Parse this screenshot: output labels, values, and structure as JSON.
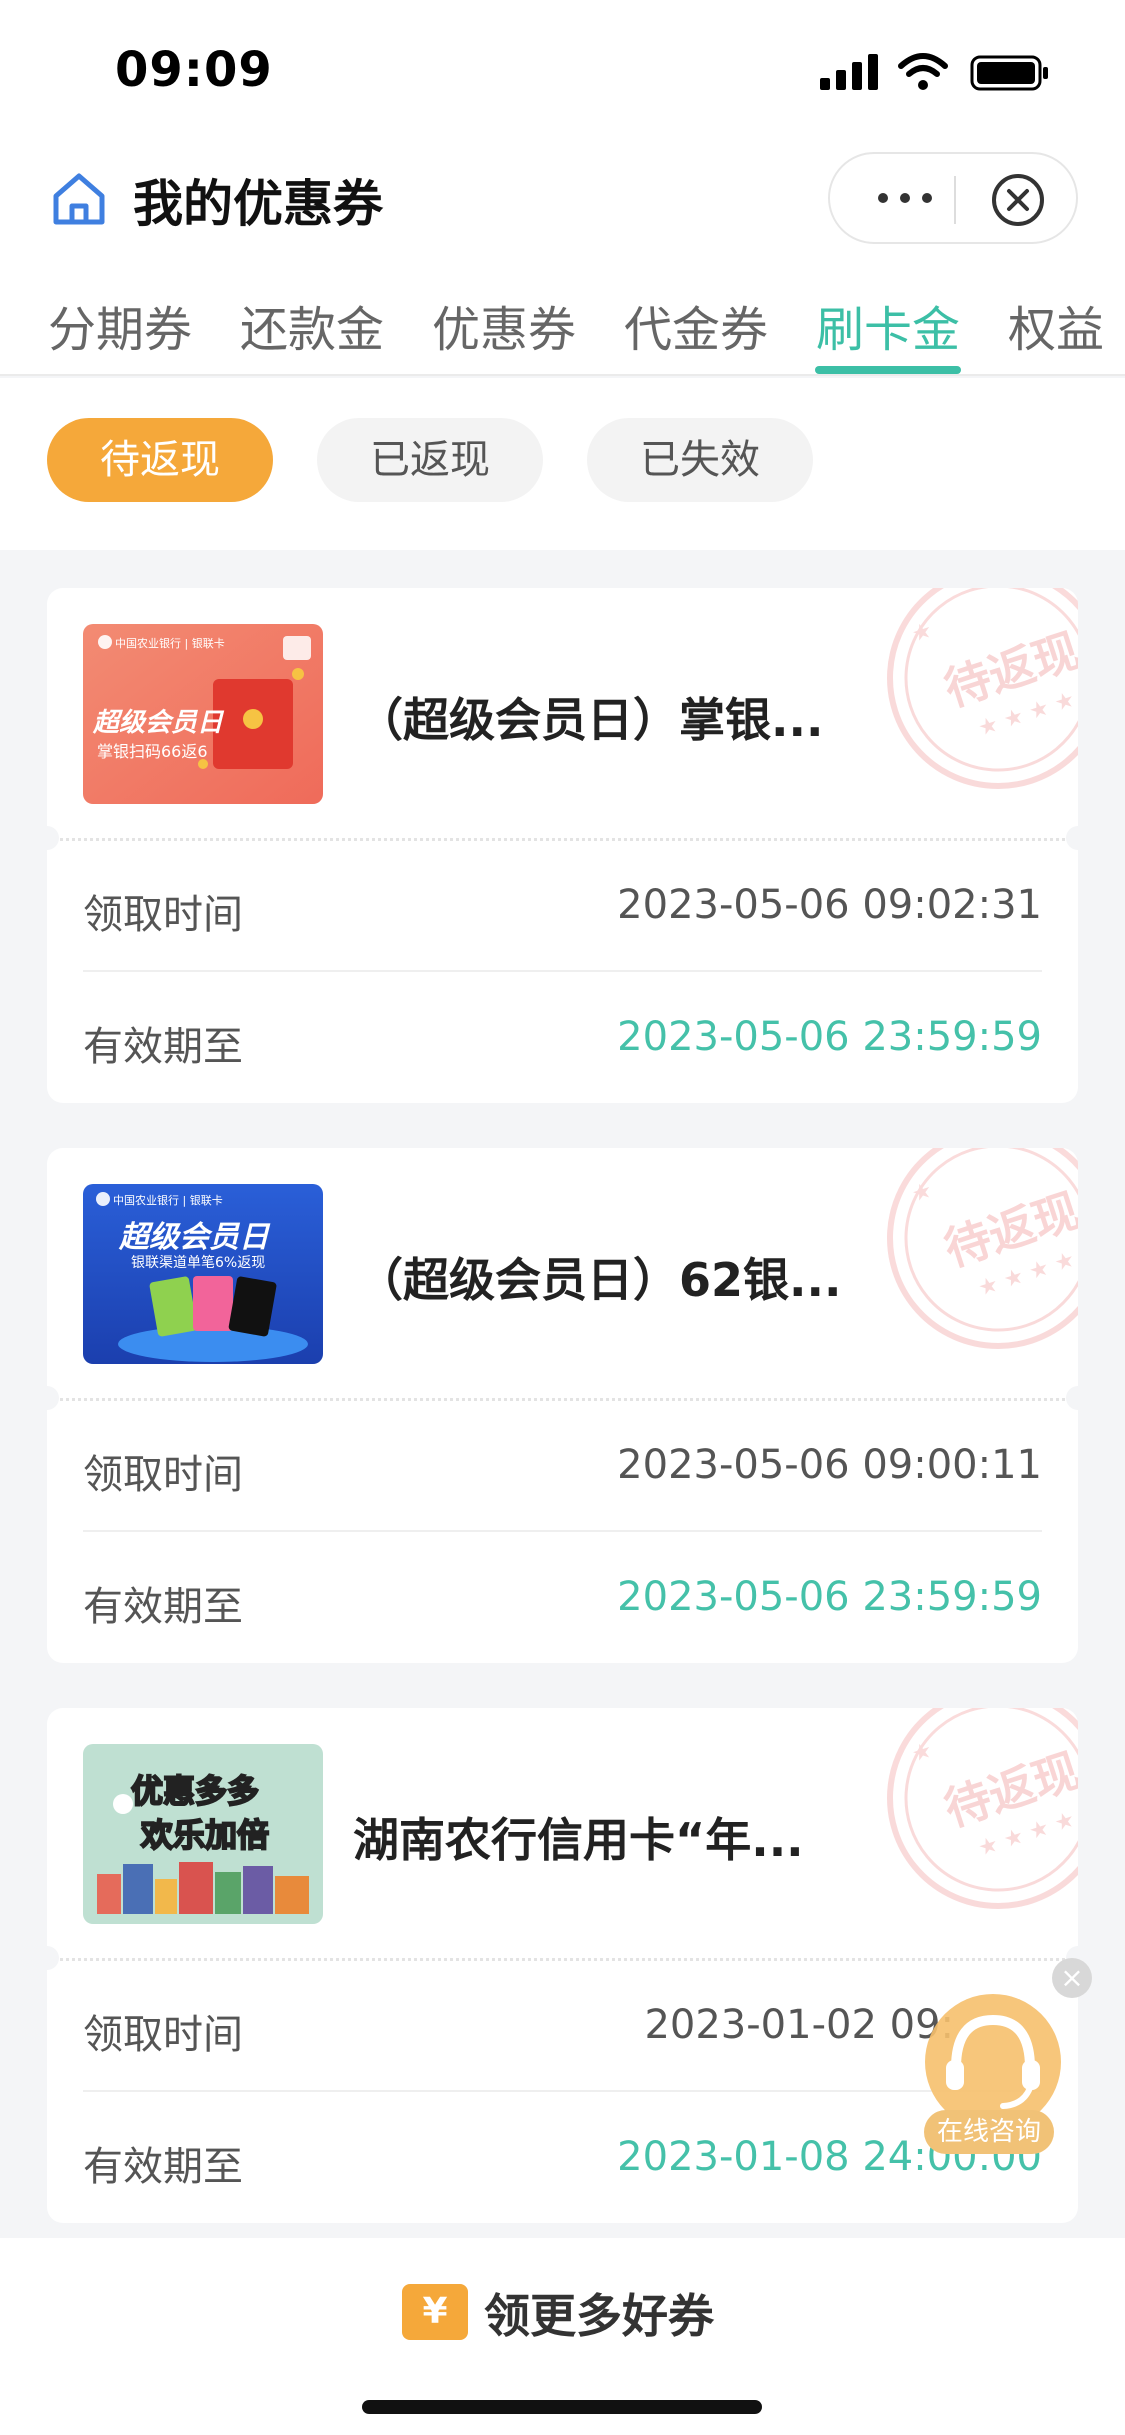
{
  "status_bar": {
    "time": "09:09"
  },
  "header": {
    "title": "我的优惠券"
  },
  "tabs": [
    {
      "label": "分期券",
      "active": false
    },
    {
      "label": "还款金",
      "active": false
    },
    {
      "label": "优惠券",
      "active": false
    },
    {
      "label": "代金券",
      "active": false
    },
    {
      "label": "刷卡金",
      "active": true
    },
    {
      "label": "权益",
      "active": false
    }
  ],
  "filters": [
    {
      "label": "待返现",
      "active": true
    },
    {
      "label": "已返现",
      "active": false
    },
    {
      "label": "已失效",
      "active": false
    }
  ],
  "cards": [
    {
      "title": "（超级会员日）掌银...",
      "stamp": "待返现",
      "thumb_text": "超级会员日",
      "thumb_sub": "掌银扫码66返6",
      "receive_label": "领取时间",
      "receive_time": "2023-05-06 09:02:31",
      "expire_label": "有效期至",
      "expire_time": "2023-05-06 23:59:59"
    },
    {
      "title": "（超级会员日）62银...",
      "stamp": "待返现",
      "thumb_text": "超级会员日",
      "thumb_sub": "银联渠道单笔6%返现",
      "receive_label": "领取时间",
      "receive_time": "2023-05-06 09:00:11",
      "expire_label": "有效期至",
      "expire_time": "2023-05-06 23:59:59"
    },
    {
      "title": "湖南农行信用卡“年...",
      "stamp": "待返现",
      "thumb_text": "优惠多多",
      "thumb_sub": "欢乐加倍",
      "receive_label": "领取时间",
      "receive_time": "2023-01-02 09:",
      "expire_label": "有效期至",
      "expire_time": "2023-01-08 24:00:00"
    }
  ],
  "consult": {
    "label": "在线咨询"
  },
  "bottom": {
    "label": "领更多好券",
    "icon_char": "¥"
  },
  "colors": {
    "accent_green": "#3cbfa6",
    "accent_orange": "#f5a83a",
    "stamp_red": "#e65a5a"
  }
}
